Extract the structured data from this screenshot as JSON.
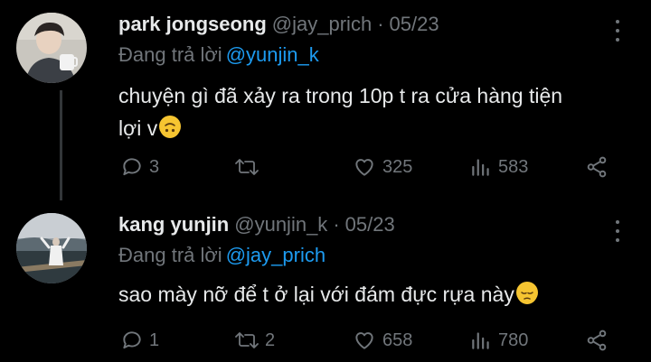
{
  "tweets": [
    {
      "name": "park jongseong",
      "handle": "@jay_prich",
      "separator": "·",
      "date": "05/23",
      "replying_prefix": "Đang trả lời",
      "replying_to": "@yunjin_k",
      "text_line1": "chuyện gì đã xảy ra trong 10p t ra cửa hàng tiện",
      "text_line2": "lợi v",
      "emoji": "upside-down-face-emoji",
      "replies": "3",
      "retweets": "",
      "likes": "325",
      "views": "583"
    },
    {
      "name": "kang yunjin",
      "handle": "@yunjin_k",
      "separator": "·",
      "date": "05/23",
      "replying_prefix": "Đang trả lời",
      "replying_to": "@jay_prich",
      "text_line1": "sao mày nỡ để t ở lại với đám đực rựa này",
      "emoji": "pensive-face-emoji",
      "replies": "1",
      "retweets": "2",
      "likes": "658",
      "views": "780"
    }
  ],
  "colors": {
    "background": "#000000",
    "text": "#e7e9ea",
    "muted": "#71767b",
    "link": "#1d9bf0",
    "thread_line": "#333639"
  }
}
